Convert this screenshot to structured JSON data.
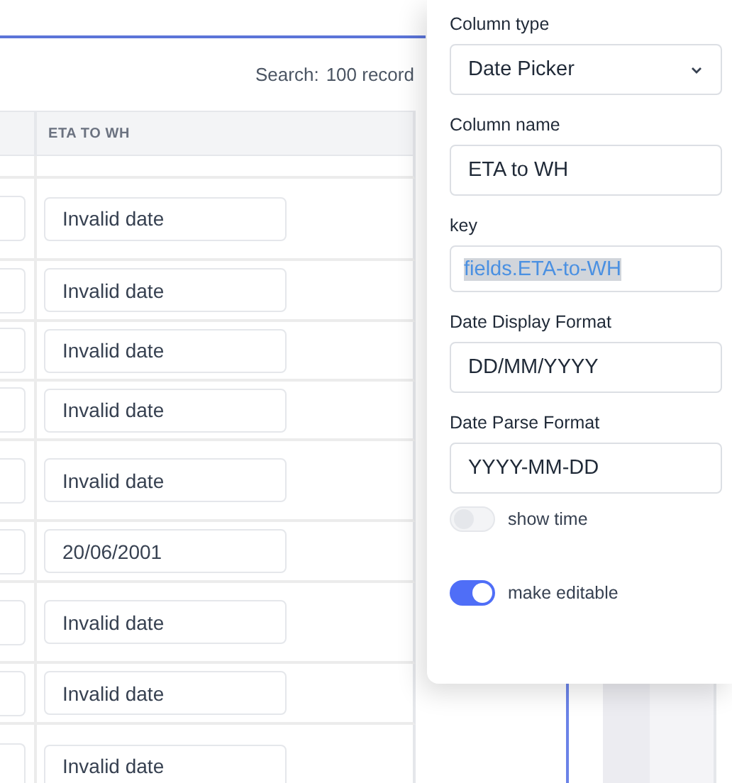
{
  "search": {
    "label": "Search:",
    "count": "100 record"
  },
  "table": {
    "columns": [
      "ETA TO WH"
    ],
    "rows": [
      {
        "eta_to_wh": "Invalid date"
      },
      {
        "eta_to_wh": "Invalid date"
      },
      {
        "eta_to_wh": "Invalid date"
      },
      {
        "eta_to_wh": "Invalid date"
      },
      {
        "eta_to_wh": "Invalid date"
      },
      {
        "eta_to_wh": "20/06/2001"
      },
      {
        "eta_to_wh": "Invalid date"
      },
      {
        "eta_to_wh": "Invalid date"
      },
      {
        "eta_to_wh": "Invalid date"
      }
    ]
  },
  "panel": {
    "fields": [
      {
        "kind": "select",
        "label": "Column type",
        "value": "Date Picker"
      },
      {
        "kind": "input",
        "label": "Column name",
        "value": "ETA to WH"
      },
      {
        "kind": "input",
        "label": "key",
        "value": "fields.ETA-to-WH",
        "highlighted": true
      },
      {
        "kind": "input",
        "label": "Date Display Format",
        "value": "DD/MM/YYYY"
      },
      {
        "kind": "input",
        "label": "Date Parse Format",
        "value": "YYYY-MM-DD"
      }
    ],
    "toggles": [
      {
        "label": "show time",
        "on": false
      },
      {
        "label": "make editable",
        "on": true
      }
    ]
  }
}
